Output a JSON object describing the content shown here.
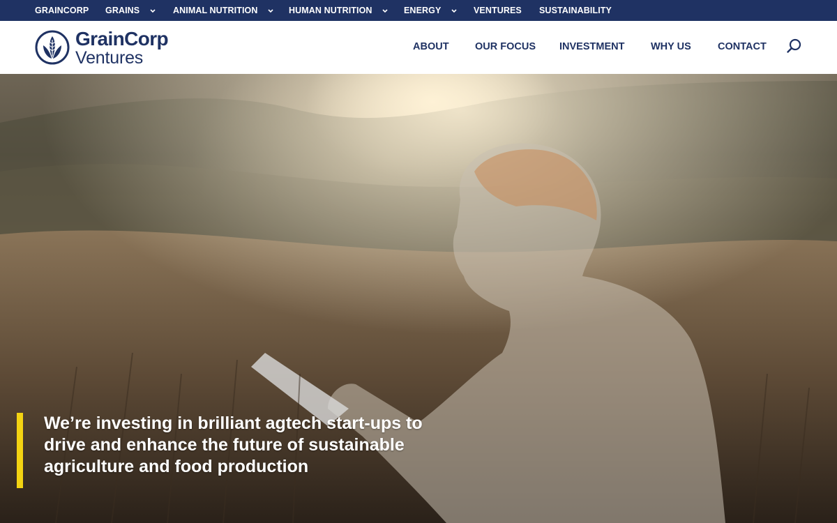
{
  "topbar": {
    "items": [
      {
        "label": "GRAINCORP",
        "dropdown": false
      },
      {
        "label": "GRAINS",
        "dropdown": true
      },
      {
        "label": "ANIMAL NUTRITION",
        "dropdown": true
      },
      {
        "label": "HUMAN NUTRITION",
        "dropdown": true
      },
      {
        "label": "ENERGY",
        "dropdown": true
      },
      {
        "label": "VENTURES",
        "dropdown": false
      },
      {
        "label": "SUSTAINABILITY",
        "dropdown": false
      }
    ]
  },
  "logo": {
    "line1": "GrainCorp",
    "line2": "Ventures"
  },
  "nav": {
    "items": [
      "ABOUT",
      "OUR FOCUS",
      "INVESTMENT",
      "WHY US",
      "CONTACT"
    ],
    "search_icon": "search-icon"
  },
  "hero": {
    "headline": "We’re investing in brilliant agtech start-ups to drive and enhance the future of sustainable agriculture and food production"
  },
  "colors": {
    "navy": "#1f3263",
    "accent": "#f3d312",
    "white": "#ffffff"
  }
}
